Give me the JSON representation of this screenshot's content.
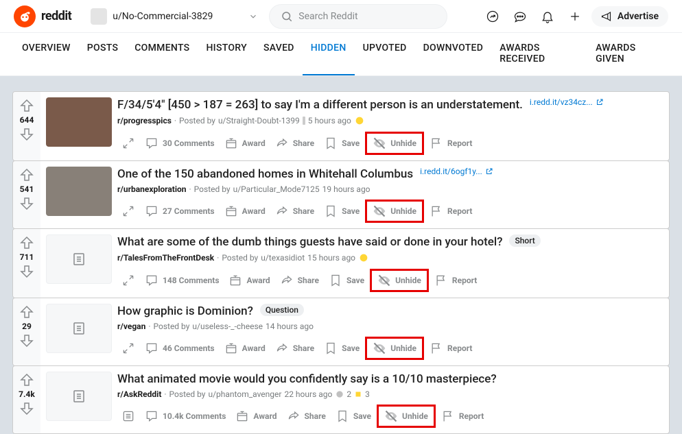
{
  "header": {
    "brand": "reddit",
    "username": "u/No-Commercial-3829",
    "search_placeholder": "Search Reddit",
    "advertise": "Advertise"
  },
  "tabs": [
    "OVERVIEW",
    "POSTS",
    "COMMENTS",
    "HISTORY",
    "SAVED",
    "HIDDEN",
    "UPVOTED",
    "DOWNVOTED",
    "AWARDS RECEIVED",
    "AWARDS GIVEN"
  ],
  "active_tab": "HIDDEN",
  "action_labels": {
    "award": "Award",
    "share": "Share",
    "save": "Save",
    "unhide": "Unhide",
    "report": "Report"
  },
  "posts": [
    {
      "score": "644",
      "title": "F/34/5'4\" [450 > 187 = 263] to say I'm a different person is an understatement.",
      "link": "i.redd.it/vz34cz...",
      "has_link": true,
      "subreddit": "r/progresspics",
      "author": "u/Straight-Doubt-1399",
      "age": "5 hours ago",
      "comments": "30 Comments",
      "thumb": "image",
      "flair": "",
      "trailing_icon": "cake",
      "leading_expand": true
    },
    {
      "score": "541",
      "title": "One of the 150 abandoned homes in Whitehall Columbus",
      "link": "i.redd.it/6ogf1y...",
      "has_link": true,
      "subreddit": "r/urbanexploration",
      "author": "u/Particular_Mode7125",
      "age": "19 hours ago",
      "comments": "27 Comments",
      "thumb": "image",
      "flair": "",
      "trailing_icon": "",
      "leading_expand": true
    },
    {
      "score": "711",
      "title": "What are some of the dumb things guests have said or done in your hotel?",
      "link": "",
      "has_link": false,
      "subreddit": "r/TalesFromTheFrontDesk",
      "author": "u/texasidiot",
      "age": "15 hours ago",
      "comments": "148 Comments",
      "thumb": "text",
      "flair": "Short",
      "trailing_icon": "face",
      "leading_expand": true
    },
    {
      "score": "29",
      "title": "How graphic is Dominion?",
      "link": "",
      "has_link": false,
      "subreddit": "r/vegan",
      "author": "u/useless-_-cheese",
      "age": "14 hours ago",
      "comments": "46 Comments",
      "thumb": "text",
      "flair": "Question",
      "trailing_icon": "",
      "leading_expand": true
    },
    {
      "score": "7.4k",
      "title": "What animated movie would you confidently say is a 10/10 masterpiece?",
      "link": "",
      "has_link": false,
      "subreddit": "r/AskReddit",
      "author": "u/phantom_avenger",
      "age": "22 hours ago",
      "comments": "10.4k Comments",
      "thumb": "text",
      "flair": "",
      "trailing_icon": "",
      "leading_expand": false,
      "awards": "2 3"
    }
  ]
}
